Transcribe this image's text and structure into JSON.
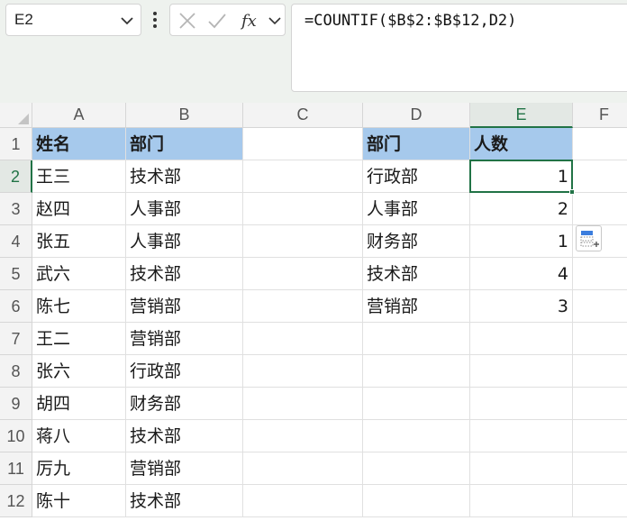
{
  "name_box": {
    "value": "E2"
  },
  "formula_bar": {
    "formula": "=COUNTIF($B$2:$B$12,D2)",
    "icons": [
      "more-options-icon",
      "cancel-icon",
      "confirm-icon",
      "insert-function-icon",
      "chevron-down-icon"
    ]
  },
  "columns": [
    "A",
    "B",
    "C",
    "D",
    "E",
    "F"
  ],
  "rows": [
    "1",
    "2",
    "3",
    "4",
    "5",
    "6",
    "7",
    "8",
    "9",
    "10",
    "11",
    "12"
  ],
  "selected_cell": {
    "column": "E",
    "row": "2"
  },
  "colors": {
    "header_fill": "#a6c9ec",
    "selection": "#217346"
  },
  "cells": {
    "A1": "姓名",
    "B1": "部门",
    "D1": "部门",
    "E1": "人数",
    "A2": "王三",
    "B2": "技术部",
    "D2": "行政部",
    "E2": "1",
    "A3": "赵四",
    "B3": "人事部",
    "D3": "人事部",
    "E3": "2",
    "A4": "张五",
    "B4": "人事部",
    "D4": "财务部",
    "E4": "1",
    "A5": "武六",
    "B5": "技术部",
    "D5": "技术部",
    "E5": "4",
    "A6": "陈七",
    "B6": "营销部",
    "D6": "营销部",
    "E6": "3",
    "A7": "王二",
    "B7": "营销部",
    "A8": "张六",
    "B8": "行政部",
    "A9": "胡四",
    "B9": "财务部",
    "A10": "蒋八",
    "B10": "技术部",
    "A11": "厉九",
    "B11": "营销部",
    "A12": "陈十",
    "B12": "技术部"
  }
}
